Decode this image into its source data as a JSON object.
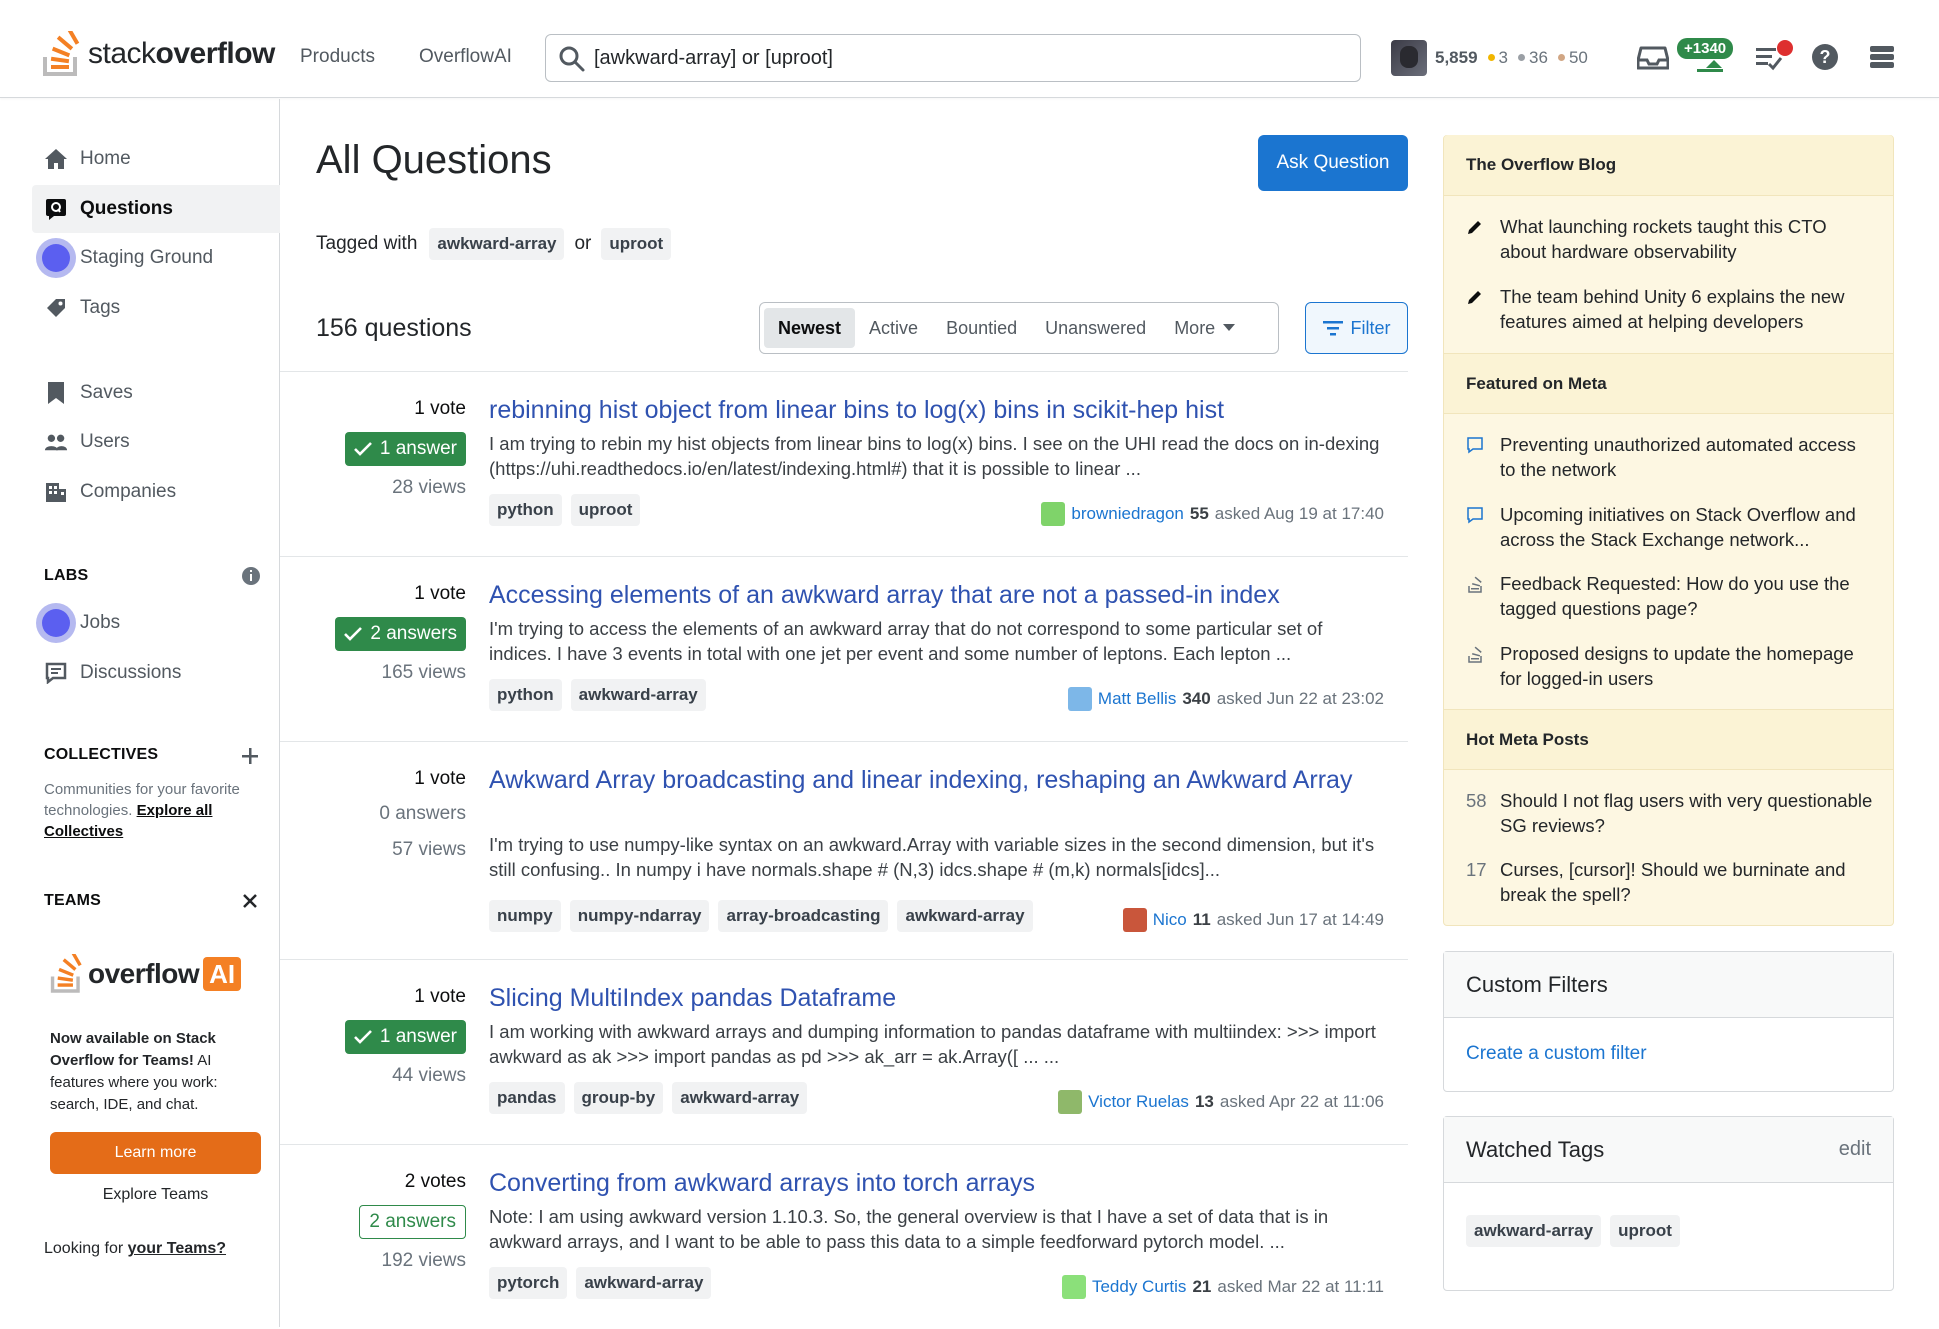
{
  "header": {
    "logo_light": "stack",
    "logo_bold": "overflow",
    "nav": [
      "Products",
      "OverflowAI"
    ],
    "search_value": "[awkward-array] or [uproot]",
    "reputation": "5,859",
    "badges": {
      "gold": "3",
      "silver": "36",
      "bronze": "50"
    },
    "rep_change": "+1340",
    "colors": {
      "gold": "#f1b600",
      "silver": "#9a9fa5",
      "bronze": "#d1a684"
    }
  },
  "sidebar": {
    "items": [
      {
        "label": "Home",
        "icon": "home-icon"
      },
      {
        "label": "Questions",
        "icon": "questions-icon"
      },
      {
        "label": "Staging Ground",
        "icon": "staging-ground-icon"
      },
      {
        "label": "Tags",
        "icon": "tag-icon"
      },
      {
        "label": "Saves",
        "icon": "bookmark-icon"
      },
      {
        "label": "Users",
        "icon": "users-icon"
      },
      {
        "label": "Companies",
        "icon": "building-icon"
      }
    ],
    "labs_heading": "LABS",
    "labs_items": [
      {
        "label": "Jobs",
        "icon": "briefcase-icon"
      },
      {
        "label": "Discussions",
        "icon": "discussion-icon"
      }
    ],
    "collectives_heading": "COLLECTIVES",
    "collectives_text": "Communities for your favorite technologies.",
    "collectives_link": "Explore all Collectives",
    "teams_heading": "TEAMS",
    "promo_logo_text": "overflow",
    "promo_logo_ai": "AI",
    "promo_bold": "Now available on Stack Overflow for Teams!",
    "promo_text": " AI features where you work: search, IDE, and chat.",
    "learn_more": "Learn more",
    "explore_teams": "Explore Teams",
    "looking_for": "Looking for ",
    "your_teams": "your Teams?"
  },
  "main": {
    "title": "All Questions",
    "ask_button": "Ask Question",
    "tagged_with": "Tagged with",
    "tagged_or": "or",
    "tagged_tags": [
      "awkward-array",
      "uproot"
    ],
    "question_count": "156 questions",
    "sort_tabs": [
      "Newest",
      "Active",
      "Bountied",
      "Unanswered",
      "More"
    ],
    "filter_button": "Filter"
  },
  "questions": [
    {
      "votes": "1 vote",
      "answers": "1 answer",
      "answer_state": "accepted",
      "views": "28 views",
      "title": "rebinning hist object from linear bins to log(x) bins in scikit-hep hist",
      "excerpt": "I am trying to rebin my hist objects from linear bins to log(x) bins. I see on the UHI read the docs on in-dexing (https://uhi.readthedocs.io/en/latest/indexing.html#) that it is possible to linear ...",
      "tags": [
        "python",
        "uproot"
      ],
      "user": "browniedragon",
      "user_rep": "55",
      "asked": "asked Aug 19 at 17:40",
      "avatar_color": "#7fd36a"
    },
    {
      "votes": "1 vote",
      "answers": "2 answers",
      "answer_state": "accepted",
      "views": "165 views",
      "title": "Accessing elements of an awkward array that are not a passed-in index",
      "excerpt": "I'm trying to access the elements of an awkward array that do not correspond to some particular set of indices. I have 3 events in total with one jet per event and some number of leptons. Each lepton ...",
      "tags": [
        "python",
        "awkward-array"
      ],
      "user": "Matt Bellis",
      "user_rep": "340",
      "asked": "asked Jun 22 at 23:02",
      "avatar_color": "#7db7e8"
    },
    {
      "votes": "1 vote",
      "answers": "0 answers",
      "answer_state": "none",
      "views": "57 views",
      "title": "Awkward Array broadcasting and linear indexing, reshaping an Awkward Array",
      "excerpt": "I'm trying to use numpy-like syntax on an awkward.Array with variable sizes in the second dimension, but it's still confusing.. In numpy i have normals.shape # (N,3) idcs.shape # (m,k) normals[idcs]...",
      "tags": [
        "numpy",
        "numpy-ndarray",
        "array-broadcasting",
        "awkward-array"
      ],
      "user": "Nico",
      "user_rep": "11",
      "asked": "asked Jun 17 at 14:49",
      "avatar_color": "#c9563b"
    },
    {
      "votes": "1 vote",
      "answers": "1 answer",
      "answer_state": "accepted",
      "views": "44 views",
      "title": "Slicing MultiIndex pandas Dataframe",
      "excerpt": "I am working with awkward arrays and dumping information to pandas dataframe with multiindex: >>> import awkward as ak >>> import pandas as pd >>> ak_arr = ak.Array([ ... ...",
      "tags": [
        "pandas",
        "group-by",
        "awkward-array"
      ],
      "user": "Victor Ruelas",
      "user_rep": "13",
      "asked": "asked Apr 22 at 11:06",
      "avatar_color": "#8fb86a"
    },
    {
      "votes": "2 votes",
      "answers": "2 answers",
      "answer_state": "outlined",
      "views": "192 views",
      "title": "Converting from awkward arrays into torch arrays",
      "excerpt": "Note: I am using awkward version 1.10.3. So, the general overview is that I have a set of data that is in awkward arrays, and I want to be able to pass this data to a simple feedforward pytorch model. ...",
      "tags": [
        "pytorch",
        "awkward-array"
      ],
      "user": "Teddy Curtis",
      "user_rep": "21",
      "asked": "asked Mar 22 at 11:11",
      "avatar_color": "#8be07a"
    }
  ],
  "right": {
    "blog_heading": "The Overflow Blog",
    "blog_items": [
      "What launching rockets taught this CTO about hardware observability",
      "The team behind Unity 6 explains the new features aimed at helping developers"
    ],
    "meta_heading": "Featured on Meta",
    "meta_items": [
      "Preventing unauthorized automated access to the network",
      "Upcoming initiatives on Stack Overflow and across the Stack Exchange network...",
      "Feedback Requested: How do you use the tagged questions page?",
      "Proposed designs to update the homepage for logged-in users"
    ],
    "hot_heading": "Hot Meta Posts",
    "hot_items": [
      {
        "count": "58",
        "text": "Should I not flag users with very questionable SG reviews?"
      },
      {
        "count": "17",
        "text": "Curses, [cursor]! Should we burninate and break the spell?"
      }
    ],
    "custom_filters_heading": "Custom Filters",
    "custom_filters_link": "Create a custom filter",
    "watched_heading": "Watched Tags",
    "watched_edit": "edit",
    "watched_tags": [
      "awkward-array",
      "uproot"
    ]
  }
}
